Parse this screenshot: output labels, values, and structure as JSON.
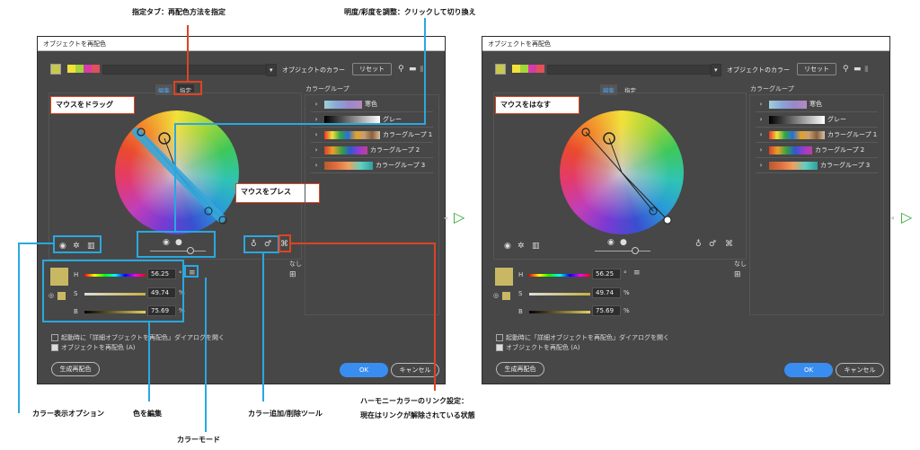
{
  "annotations": {
    "top_left": "指定タブ：再配色方法を指定",
    "top_right": "明度/彩度を調整：クリックして切り換え",
    "color_view": "カラー表示オプション",
    "edit_color": "色を編集",
    "add_remove": "カラー追加/削除ツール",
    "harmony_line1": "ハーモニーカラーのリンク設定：",
    "harmony_line2": "現在はリンクが解除されている状態",
    "color_mode": "カラーモード",
    "drag": "マウスをドラッグ",
    "press": "マウスをプレス",
    "release": "マウスをはなす"
  },
  "dialog": {
    "title": "オブジェクトを再配色",
    "object_colors": "オブジェクトのカラー",
    "reset": "リセット",
    "tab_edit": "編集",
    "tab_assign": "指定",
    "groups_title": "カラーグループ",
    "groups": [
      {
        "label": "寒色",
        "colors": [
          "#9fd0d6",
          "#8aa6d8",
          "#9a88c8",
          "#b58ac0"
        ]
      },
      {
        "label": "グレー",
        "colors": [
          "#000000",
          "#222222",
          "#444444",
          "#666666",
          "#888888",
          "#aaaaaa",
          "#cccccc",
          "#eeeeee",
          "#ffffff"
        ]
      },
      {
        "label": "カラーグループ 1",
        "colors": [
          "#e8362a",
          "#f2e13a",
          "#2fa64a",
          "#2a6fd8",
          "#e3a12a",
          "#c8a070",
          "#a87850",
          "#886040",
          "#d8c0a0"
        ]
      },
      {
        "label": "カラーグループ 2",
        "colors": [
          "#d8402a",
          "#e8a02a",
          "#3aa040",
          "#2a5ad0",
          "#9a3ad0",
          "#c040a0"
        ]
      },
      {
        "label": "カラーグループ 3",
        "colors": [
          "#b85a30",
          "#e07040",
          "#f0a060",
          "#60d0c0",
          "#40c0b0",
          "#30a0a0"
        ]
      }
    ],
    "none": "なし",
    "h_label": "H",
    "s_label": "S",
    "b_label": "B",
    "h_value": "56.25",
    "s_value": "49.74",
    "b_value": "75.69",
    "deg": "°",
    "pct": "%",
    "open_adv": "起動時に「詳細オブジェクトを再配色」ダイアログを開く",
    "recolor": "オブジェクトを再配色 (A)",
    "gen": "生成再配色",
    "ok": "OK",
    "cancel": "キャンセル",
    "top_colors": [
      "#f2e13a",
      "#a3d53b",
      "#d83aa8",
      "#e3505a"
    ],
    "base_color": "#c8b864"
  }
}
